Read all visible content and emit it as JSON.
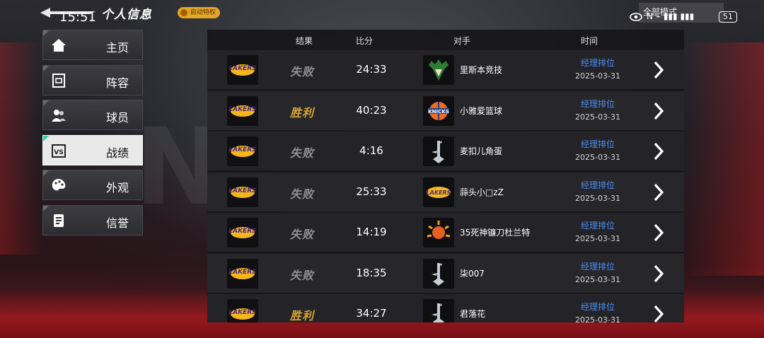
{
  "status_bar": {
    "time": "15:51",
    "mode": "全部模式",
    "network_icons": "N ⌁ ▮▮▮ ▮▮▮",
    "battery": "51"
  },
  "header": {
    "title": "个人信息",
    "badge": "启动特权"
  },
  "sidebar": {
    "items": [
      {
        "label": "主页",
        "icon": "home-icon",
        "active": false
      },
      {
        "label": "阵容",
        "icon": "court-icon",
        "active": false
      },
      {
        "label": "球员",
        "icon": "players-icon",
        "active": false
      },
      {
        "label": "战绩",
        "icon": "vs-icon",
        "active": true
      },
      {
        "label": "外观",
        "icon": "palette-icon",
        "active": false
      },
      {
        "label": "信誉",
        "icon": "badge-icon",
        "active": false
      }
    ]
  },
  "table": {
    "headers": {
      "result": "结果",
      "score": "比分",
      "opponent": "对手",
      "time": "时间"
    },
    "rows": [
      {
        "result": "失败",
        "outcome": "loss",
        "score": "24:33",
        "opponent": "里斯本竞技",
        "opponent_logo": "bucks-logo",
        "type": "经理排位",
        "date": "2025-03-31"
      },
      {
        "result": "胜利",
        "outcome": "win",
        "score": "40:23",
        "opponent": "小雅爱篮球",
        "opponent_logo": "knicks-logo",
        "type": "经理排位",
        "date": "2025-03-31"
      },
      {
        "result": "失败",
        "outcome": "loss",
        "score": "4:16",
        "opponent": "麦扣儿角蛋",
        "opponent_logo": "spurs-logo",
        "type": "经理排位",
        "date": "2025-03-31"
      },
      {
        "result": "失败",
        "outcome": "loss",
        "score": "25:33",
        "opponent": "蒜头小□zZ",
        "opponent_logo": "lakers-logo",
        "type": "经理排位",
        "date": "2025-03-31"
      },
      {
        "result": "失败",
        "outcome": "loss",
        "score": "14:19",
        "opponent": "35死神镰刀杜兰特",
        "opponent_logo": "suns-logo",
        "type": "经理排位",
        "date": "2025-03-31"
      },
      {
        "result": "失败",
        "outcome": "loss",
        "score": "18:35",
        "opponent": "柒007",
        "opponent_logo": "spurs-logo",
        "type": "经理排位",
        "date": "2025-03-31"
      },
      {
        "result": "胜利",
        "outcome": "win",
        "score": "34:27",
        "opponent": "君落花",
        "opponent_logo": "spurs-logo",
        "type": "经理排位",
        "date": "2025-03-31"
      }
    ],
    "own_logo_text": "LAKERS"
  },
  "colors": {
    "win": "#d9a733",
    "loss": "#8f8f93",
    "link": "#4c8df0",
    "active_accent": "#28d0a8"
  }
}
